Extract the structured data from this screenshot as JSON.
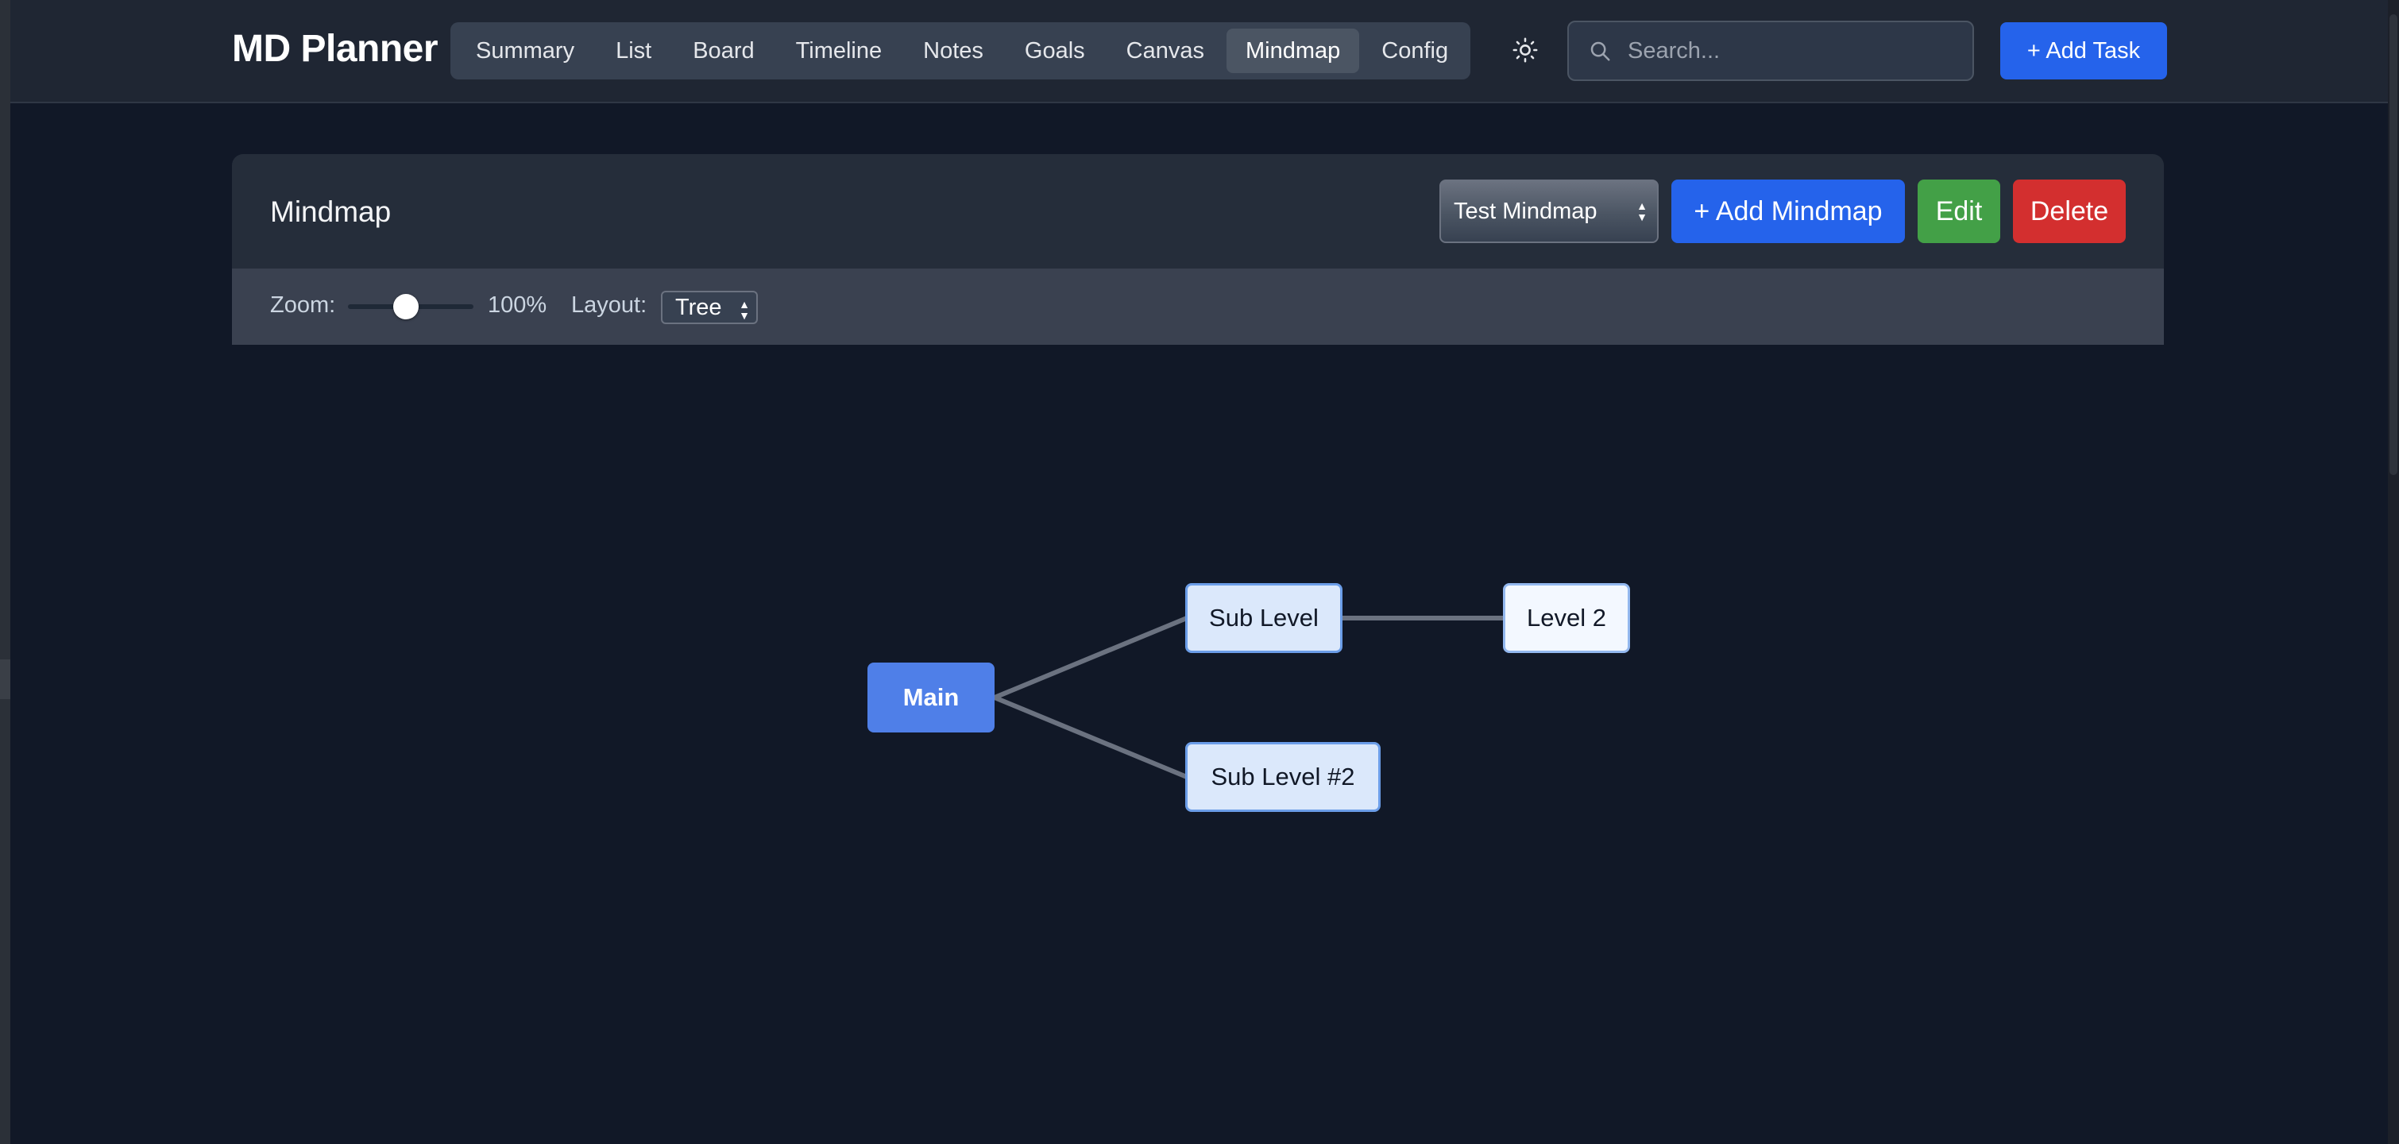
{
  "app": {
    "title": "MD Planner"
  },
  "nav": {
    "tabs": [
      {
        "label": "Summary",
        "active": false
      },
      {
        "label": "List",
        "active": false
      },
      {
        "label": "Board",
        "active": false
      },
      {
        "label": "Timeline",
        "active": false
      },
      {
        "label": "Notes",
        "active": false
      },
      {
        "label": "Goals",
        "active": false
      },
      {
        "label": "Canvas",
        "active": false
      },
      {
        "label": "Mindmap",
        "active": true
      },
      {
        "label": "Config",
        "active": false
      }
    ]
  },
  "header": {
    "theme_icon": "sun-icon",
    "search": {
      "placeholder": "Search...",
      "value": "",
      "icon": "search-icon"
    },
    "add_task_label": "+ Add Task"
  },
  "panel": {
    "title": "Mindmap",
    "selected_mindmap": "Test Mindmap",
    "add_label": "+ Add Mindmap",
    "edit_label": "Edit",
    "delete_label": "Delete"
  },
  "toolbar": {
    "zoom_label": "Zoom:",
    "zoom_value": "100%",
    "zoom_fraction": 0.45,
    "layout_label": "Layout:",
    "layout_value": "Tree"
  },
  "mindmap": {
    "nodes": {
      "main": "Main",
      "sub1": "Sub Level",
      "sub2": "Sub Level #2",
      "l2": "Level 2"
    }
  },
  "colors": {
    "background": "#111827",
    "header": "#1f2633",
    "primary": "#2563eb",
    "edit": "#43a047",
    "delete": "#d32f2f",
    "main_node": "#4f7fe8",
    "connector": "#6b7280"
  }
}
